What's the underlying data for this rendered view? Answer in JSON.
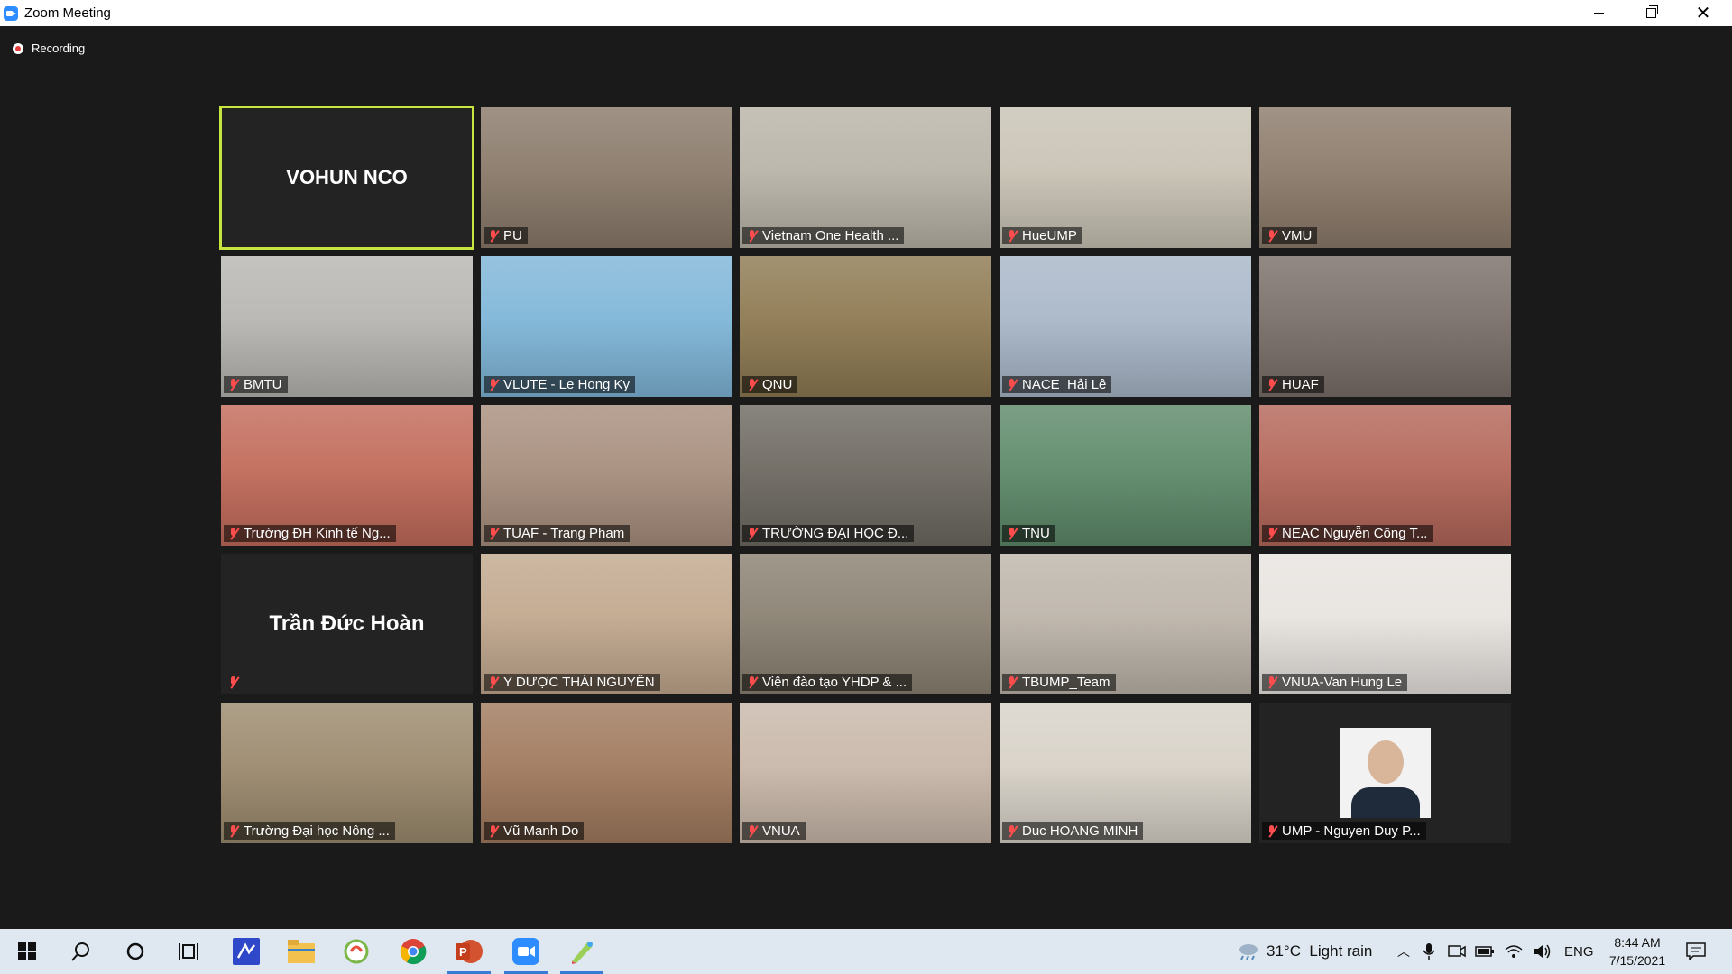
{
  "window": {
    "title": "Zoom Meeting"
  },
  "recording": {
    "label": "Recording"
  },
  "participants": [
    {
      "name": "VOHUN NCO",
      "mode": "name-only",
      "active": true,
      "bg": "#232323"
    },
    {
      "name": "PU",
      "mode": "video",
      "bg": "#8a7a6a"
    },
    {
      "name": "Vietnam One Health ...",
      "mode": "video",
      "bg": "#b9b4a8"
    },
    {
      "name": "HueUMP",
      "mode": "video",
      "bg": "#c9c3b5"
    },
    {
      "name": "VMU",
      "mode": "video",
      "bg": "#8c7b6b"
    },
    {
      "name": "BMTU",
      "mode": "video",
      "bg": "#b7b6b2"
    },
    {
      "name": "VLUTE - Le Hong Ky",
      "mode": "video",
      "bg": "#7fb6d8"
    },
    {
      "name": "QNU",
      "mode": "video",
      "bg": "#8e7a52"
    },
    {
      "name": "NACE_Hải Lê",
      "mode": "video",
      "bg": "#a9b7c8"
    },
    {
      "name": "HUAF",
      "mode": "video",
      "bg": "#7a6f6a"
    },
    {
      "name": "Trường ĐH Kinh tế Ng...",
      "mode": "video",
      "bg": "#c26b5a"
    },
    {
      "name": "TUAF - Trang Pham",
      "mode": "video",
      "bg": "#a88f7e"
    },
    {
      "name": "TRƯỜNG ĐẠI HỌC Đ...",
      "mode": "video",
      "bg": "#6e6a62"
    },
    {
      "name": "TNU",
      "mode": "video",
      "bg": "#5e8a6a"
    },
    {
      "name": "NEAC Nguyễn Công T...",
      "mode": "video",
      "bg": "#b4675a"
    },
    {
      "name": "Trần Đức Hoàn",
      "mode": "name-only",
      "bg": "#232323"
    },
    {
      "name": "Y DƯỢC THÁI NGUYÊN",
      "mode": "video",
      "bg": "#c2a88e"
    },
    {
      "name": "Viện đào tạo YHDP & ...",
      "mode": "video",
      "bg": "#8a8172"
    },
    {
      "name": "TBUMP_Team",
      "mode": "video",
      "bg": "#bdb5aa"
    },
    {
      "name": "VNUA-Van Hung Le",
      "mode": "video",
      "bg": "#e8e4e0"
    },
    {
      "name": "Trường Đại học Nông ...",
      "mode": "video",
      "bg": "#9c8a6e"
    },
    {
      "name": "Vũ Manh Do",
      "mode": "video",
      "bg": "#a07a5e"
    },
    {
      "name": "VNUA",
      "mode": "video",
      "bg": "#c9b8aa"
    },
    {
      "name": "Duc HOANG MINH",
      "mode": "video",
      "bg": "#d8d2c8"
    },
    {
      "name": "UMP - Nguyen Duy P...",
      "mode": "photo",
      "bg": "#232323"
    }
  ],
  "taskbar": {
    "weather": "31°C  Light rain",
    "language": "ENG",
    "time": "8:44 AM",
    "date": "7/15/2021",
    "apps": [
      "start-icon",
      "search-icon",
      "cortana-icon",
      "task-view-icon",
      "app-blue-icon",
      "file-explorer-icon",
      "wechat-like-icon",
      "chrome-icon",
      "powerpoint-icon",
      "zoom-icon",
      "paint-icon"
    ]
  }
}
